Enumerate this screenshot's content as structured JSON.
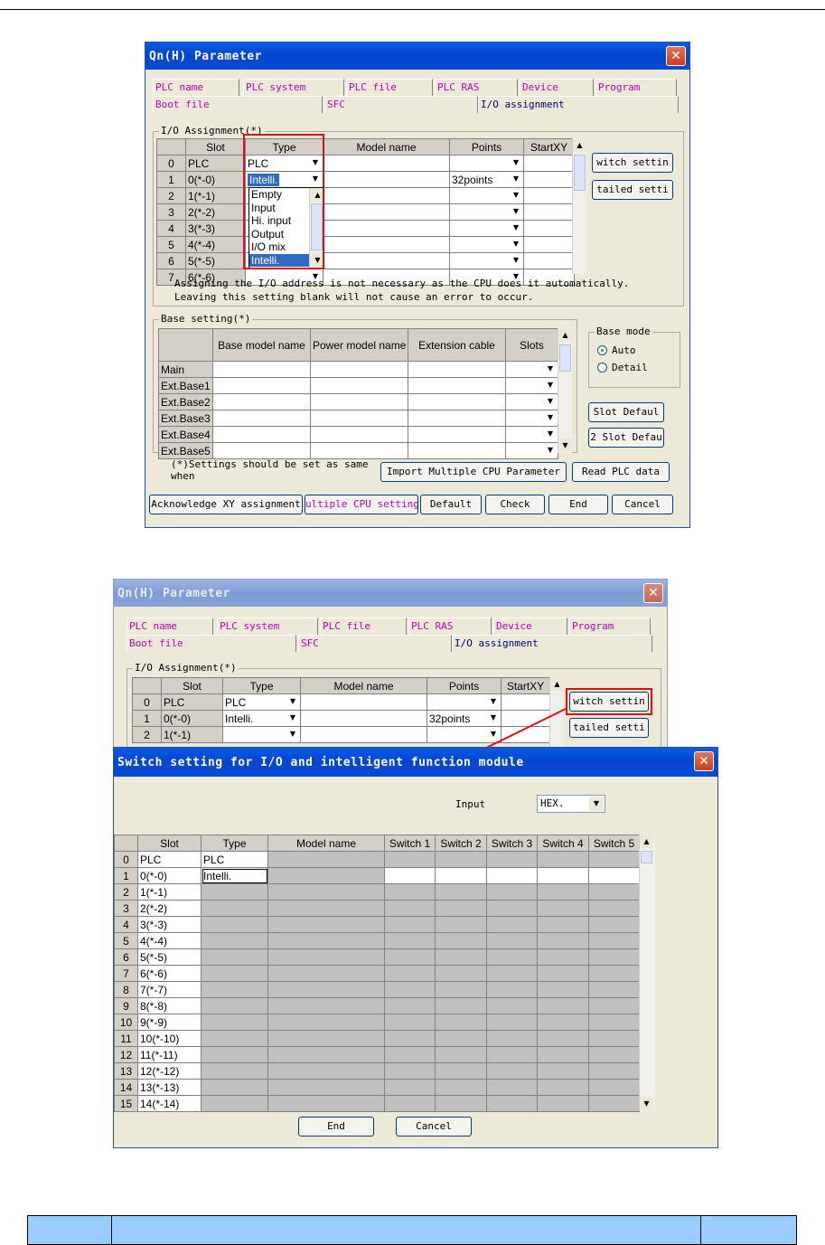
{
  "window1": {
    "title": "Qn(H) Parameter",
    "close": "✕",
    "tabs_row1": [
      "PLC name",
      "PLC system",
      "PLC file",
      "PLC RAS",
      "Device",
      "Program"
    ],
    "tabs_row2": [
      "Boot file",
      "SFC",
      "I/O assignment"
    ],
    "io_group_label": "I/O Assignment(*)",
    "io_headers": [
      "Slot",
      "Type",
      "Model name",
      "Points",
      "StartXY"
    ],
    "io_rows": [
      {
        "num": "0",
        "slot": "PLC",
        "type": "PLC",
        "model": "",
        "points": "",
        "start": ""
      },
      {
        "num": "1",
        "slot": "0(*-0)",
        "type": "Intelli.",
        "model": "",
        "points": "32points",
        "start": ""
      },
      {
        "num": "2",
        "slot": "1(*-1)",
        "type": "",
        "model": "",
        "points": "",
        "start": ""
      },
      {
        "num": "3",
        "slot": "2(*-2)",
        "type": "",
        "model": "",
        "points": "",
        "start": ""
      },
      {
        "num": "4",
        "slot": "3(*-3)",
        "type": "",
        "model": "",
        "points": "",
        "start": ""
      },
      {
        "num": "5",
        "slot": "4(*-4)",
        "type": "",
        "model": "",
        "points": "",
        "start": ""
      },
      {
        "num": "6",
        "slot": "5(*-5)",
        "type": "",
        "model": "",
        "points": "",
        "start": ""
      },
      {
        "num": "7",
        "slot": "6(*-6)",
        "type": "",
        "model": "",
        "points": "",
        "start": ""
      }
    ],
    "type_options": [
      "Empty",
      "Input",
      "Hi. input",
      "Output",
      "I/O mix",
      "Intelli."
    ],
    "switch_btn": "witch settin",
    "detail_btn": "tailed setti",
    "note1": "Assigning the I/O address is not necessary as the CPU does it automatically.",
    "note2": "Leaving this setting blank will not cause an error to occur.",
    "base_group_label": "Base setting(*)",
    "base_headers": [
      "Base model name",
      "Power model name",
      "Extension cable",
      "Slots"
    ],
    "base_rows": [
      "Main",
      "Ext.Base1",
      "Ext.Base2",
      "Ext.Base3",
      "Ext.Base4",
      "Ext.Base5"
    ],
    "base_mode_label": "Base mode",
    "radio_auto": "Auto",
    "radio_detail": "Detail",
    "slot_default_btn": "Slot Defaul",
    "slot_default2_btn": "2 Slot Defau",
    "settings_note": "(*)Settings should be set as same when",
    "import_btn": "Import Multiple CPU Parameter",
    "read_btn": "Read PLC data",
    "ack_btn": "Acknowledge XY assignment",
    "multi_btn": "ultiple CPU setting",
    "default_btn": "Default",
    "check_btn": "Check",
    "end_btn": "End",
    "cancel_btn": "Cancel"
  },
  "window2": {
    "title": "Qn(H) Parameter",
    "close": "✕",
    "tabs_row1": [
      "PLC name",
      "PLC system",
      "PLC file",
      "PLC RAS",
      "Device",
      "Program"
    ],
    "tabs_row2": [
      "Boot file",
      "SFC",
      "I/O assignment"
    ],
    "io_group_label": "I/O Assignment(*)",
    "io_headers": [
      "Slot",
      "Type",
      "Model name",
      "Points",
      "StartXY"
    ],
    "io_rows": [
      {
        "num": "0",
        "slot": "PLC",
        "type": "PLC",
        "points": ""
      },
      {
        "num": "1",
        "slot": "0(*-0)",
        "type": "Intelli.",
        "points": "32points"
      },
      {
        "num": "2",
        "slot": "1(*-1)",
        "type": "",
        "points": ""
      }
    ],
    "switch_btn": "witch settin",
    "detail_btn": "tailed setti"
  },
  "switch_dialog": {
    "title": "Switch setting for I/O and intelligent function module",
    "close": "✕",
    "input_label": "Input",
    "input_value": "HEX.",
    "headers": [
      "Slot",
      "Type",
      "Model name",
      "Switch 1",
      "Switch 2",
      "Switch 3",
      "Switch 4",
      "Switch 5"
    ],
    "rows": [
      {
        "num": "0",
        "slot": "PLC",
        "type": "PLC"
      },
      {
        "num": "1",
        "slot": "0(*-0)",
        "type": "Intelli."
      },
      {
        "num": "2",
        "slot": "1(*-1)",
        "type": ""
      },
      {
        "num": "3",
        "slot": "2(*-2)",
        "type": ""
      },
      {
        "num": "4",
        "slot": "3(*-3)",
        "type": ""
      },
      {
        "num": "5",
        "slot": "4(*-4)",
        "type": ""
      },
      {
        "num": "6",
        "slot": "5(*-5)",
        "type": ""
      },
      {
        "num": "7",
        "slot": "6(*-6)",
        "type": ""
      },
      {
        "num": "8",
        "slot": "7(*-7)",
        "type": ""
      },
      {
        "num": "9",
        "slot": "8(*-8)",
        "type": ""
      },
      {
        "num": "10",
        "slot": "9(*-9)",
        "type": ""
      },
      {
        "num": "11",
        "slot": "10(*-10)",
        "type": ""
      },
      {
        "num": "12",
        "slot": "11(*-11)",
        "type": ""
      },
      {
        "num": "13",
        "slot": "12(*-12)",
        "type": ""
      },
      {
        "num": "14",
        "slot": "13(*-13)",
        "type": ""
      },
      {
        "num": "15",
        "slot": "14(*-14)",
        "type": ""
      }
    ],
    "end_btn": "End",
    "cancel_btn": "Cancel"
  },
  "colors": {
    "highlight": "#e01010",
    "tab_text": "#c000c0",
    "selection": "#316ac5",
    "footer": "#99ccff"
  }
}
